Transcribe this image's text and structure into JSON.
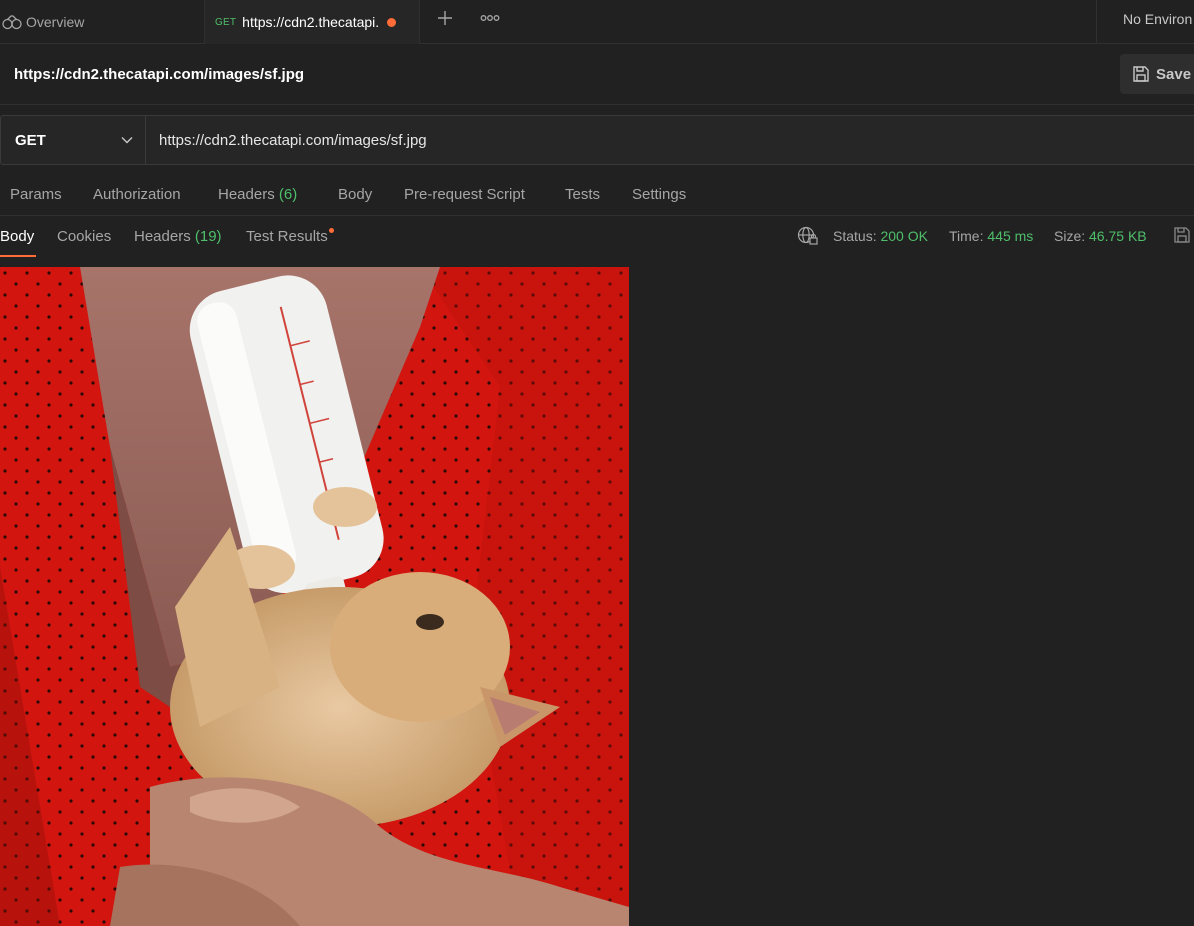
{
  "tabs": {
    "overview_label": "Overview",
    "active_method": "GET",
    "active_label": "https://cdn2.thecatapi.",
    "environment": "No Environ"
  },
  "request": {
    "title": "https://cdn2.thecatapi.com/images/sf.jpg",
    "save_label": "Save",
    "method": "GET",
    "url": "https://cdn2.thecatapi.com/images/sf.jpg"
  },
  "request_tabs": {
    "params": "Params",
    "authorization": "Authorization",
    "headers": "Headers",
    "headers_count": "(6)",
    "body": "Body",
    "prerequest": "Pre-request Script",
    "tests": "Tests",
    "settings": "Settings"
  },
  "response_tabs": {
    "body": "Body",
    "cookies": "Cookies",
    "headers": "Headers",
    "headers_count": "(19)",
    "test_results": "Test Results"
  },
  "response_status": {
    "status_label": "Status:",
    "status_value": "200 OK",
    "time_label": "Time:",
    "time_value": "445 ms",
    "size_label": "Size:",
    "size_value": "46.75 KB"
  },
  "colors": {
    "accent": "#ff6c37",
    "success": "#4fbf6b",
    "background": "#212121"
  },
  "icons": [
    "overview-icon",
    "plus-icon",
    "more-icon",
    "save-icon",
    "chevron-down-icon",
    "globe-lock-icon",
    "save-response-icon"
  ]
}
